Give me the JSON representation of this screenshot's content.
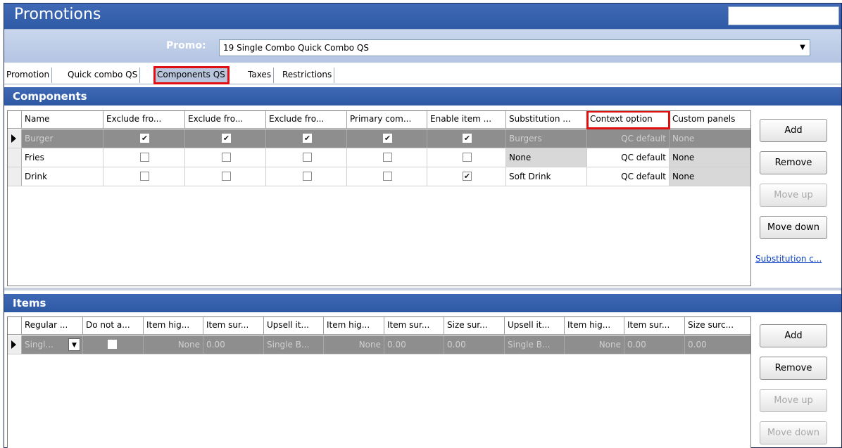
{
  "window": {
    "title": "Promotions"
  },
  "promo": {
    "label": "Promo:",
    "value": "19 Single Combo Quick Combo QS"
  },
  "tabs": [
    {
      "label": "Promotion"
    },
    {
      "label": "Quick combo QS"
    },
    {
      "label": "Components QS"
    },
    {
      "label": "Taxes"
    },
    {
      "label": "Restrictions"
    }
  ],
  "components": {
    "heading": "Components",
    "columns": [
      "Name",
      "Exclude fro...",
      "Exclude fro...",
      "Exclude fro...",
      "Primary com...",
      "Enable item ...",
      "Substitution ...",
      "Context option",
      "Custom panels"
    ],
    "rows": [
      {
        "name": "Burger",
        "checks": [
          true,
          true,
          true,
          true,
          true
        ],
        "substitution": "Burgers",
        "context": "QC default",
        "panels": "None",
        "selected": true
      },
      {
        "name": "Fries",
        "checks": [
          false,
          false,
          false,
          false,
          false
        ],
        "substitution": "None",
        "context": "QC default",
        "panels": "None",
        "selected": false
      },
      {
        "name": "Drink",
        "checks": [
          false,
          false,
          false,
          false,
          true
        ],
        "substitution": "Soft Drink",
        "context": "QC default",
        "panels": "None",
        "selected": false
      }
    ],
    "buttons": {
      "add": "Add",
      "remove": "Remove",
      "move_up": "Move up",
      "move_down": "Move down"
    },
    "link": "Substitution c..."
  },
  "items": {
    "heading": "Items",
    "columns": [
      "Regular ...",
      "Do not a...",
      "Item hig...",
      "Item sur...",
      "Upsell it...",
      "Item hig...",
      "Item sur...",
      "Size sur...",
      "Upsell it...",
      "Item hig...",
      "Item sur...",
      "Size surc..."
    ],
    "row": [
      "Singl...",
      "",
      "None",
      "0.00",
      "Single B...",
      "None",
      "0.00",
      "0.00",
      "Single B...",
      "None",
      "0.00",
      "0.00"
    ],
    "buttons": {
      "add": "Add",
      "remove": "Remove",
      "move_up": "Move up",
      "move_down": "Move down"
    }
  },
  "colors": {
    "header_blue": "#3f69b5",
    "highlight_red": "#e01010",
    "selected_row": "#8e8e8e",
    "link_blue": "#0b40c8"
  }
}
